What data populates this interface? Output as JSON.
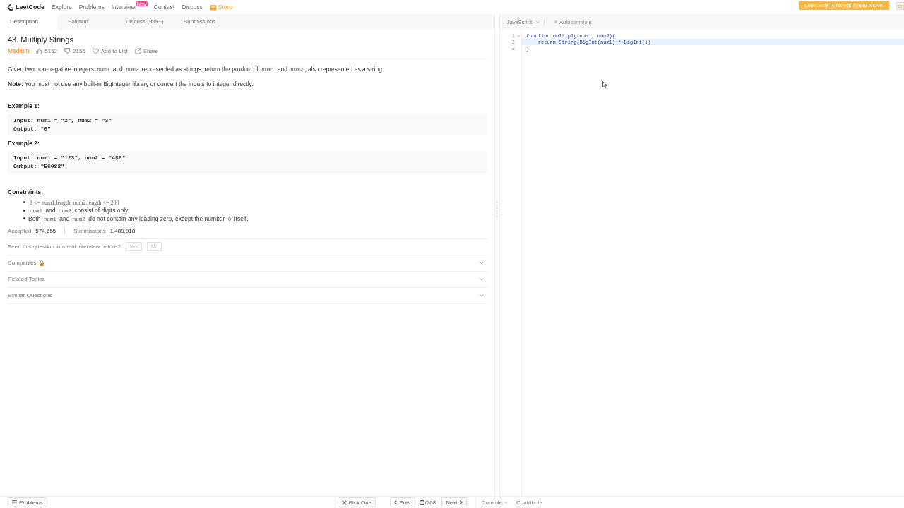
{
  "nav": {
    "logo": "LeetCode",
    "links": [
      {
        "label": "Explore"
      },
      {
        "label": "Problems"
      },
      {
        "label": "Interview",
        "badge": "New"
      },
      {
        "label": "Contest"
      },
      {
        "label": "Discuss"
      }
    ],
    "store": "Store",
    "banner": "LeetCode is hiring! Apply NOW."
  },
  "tabs": [
    {
      "label": "Description",
      "selected": true
    },
    {
      "label": "Solution",
      "selected": false
    },
    {
      "label": "Discuss (999+)",
      "selected": false
    },
    {
      "label": "Submissions",
      "selected": false
    }
  ],
  "problem": {
    "title": "43. Multiply Strings",
    "difficulty": "Medium",
    "likes": "5152",
    "dislikes": "2156",
    "add_to_list": "Add to List",
    "share": "Share",
    "paragraphs": [
      [
        {
          "kind": "text",
          "text": "Given two non-negative integers "
        },
        {
          "kind": "code",
          "text": "num1"
        },
        {
          "kind": "text",
          "text": " and "
        },
        {
          "kind": "code",
          "text": "num2"
        },
        {
          "kind": "text",
          "text": " represented as strings, return the product of "
        },
        {
          "kind": "code",
          "text": "num1"
        },
        {
          "kind": "text",
          "text": " and "
        },
        {
          "kind": "code",
          "text": "num2"
        },
        {
          "kind": "text",
          "text": ", also represented as a string."
        }
      ],
      [
        {
          "kind": "bold",
          "text": "Note:"
        },
        {
          "kind": "text",
          "text": " You must not use any built-in BigInteger library or convert the inputs to integer directly."
        }
      ]
    ],
    "examples": [
      {
        "title": "Example 1:",
        "lines": [
          "Input: num1 = \"2\", num2 = \"3\"",
          "Output: \"6\""
        ]
      },
      {
        "title": "Example 2:",
        "lines": [
          "Input: num1 = \"123\", num2 = \"456\"",
          "Output: \"56088\""
        ]
      }
    ],
    "constraints_title": "Constraints:",
    "constraints": [
      [
        {
          "kind": "code",
          "text": "1 <= num1.length, num2.length <= 200"
        }
      ],
      [
        {
          "kind": "code",
          "text": "num1"
        },
        {
          "kind": "text",
          "text": " and "
        },
        {
          "kind": "code",
          "text": "num2"
        },
        {
          "kind": "text",
          "text": " consist of digits only."
        }
      ],
      [
        {
          "kind": "text",
          "text": "Both "
        },
        {
          "kind": "code",
          "text": "num1"
        },
        {
          "kind": "text",
          "text": " and "
        },
        {
          "kind": "code",
          "text": "num2"
        },
        {
          "kind": "text",
          "text": " do not contain any leading zero, except the number "
        },
        {
          "kind": "code",
          "text": "0"
        },
        {
          "kind": "text",
          "text": " itself."
        }
      ]
    ],
    "stats": [
      {
        "label": "Accepted",
        "value": "574,655"
      },
      {
        "label": "Submissions",
        "value": "1,489,918"
      }
    ],
    "interview": {
      "question": "Seen this question in a real interview before?",
      "buttons": [
        "Yes",
        "No"
      ]
    },
    "sections": [
      {
        "label": "Companies",
        "locked": true
      },
      {
        "label": "Related Topics",
        "locked": false
      },
      {
        "label": "Similar Questions",
        "locked": false
      }
    ]
  },
  "editor": {
    "language": "JavaScript",
    "autocomplete": {
      "label": "Autocomplete",
      "on": false
    },
    "lines": [
      {
        "number": "1",
        "text": "function multiply(num1, num2){",
        "active": false,
        "foldable": true
      },
      {
        "number": "2",
        "text": "    return String(BigInt(num1) * BigInt())",
        "active": true,
        "foldable": false
      },
      {
        "number": "3",
        "text": "}",
        "active": false,
        "foldable": false
      }
    ]
  },
  "footer": {
    "problems": "Problems",
    "pick_one": "Pick One",
    "prev": "Prev",
    "counter": "/268",
    "next": "Next",
    "console": "Console",
    "contribute": "Contribute"
  }
}
